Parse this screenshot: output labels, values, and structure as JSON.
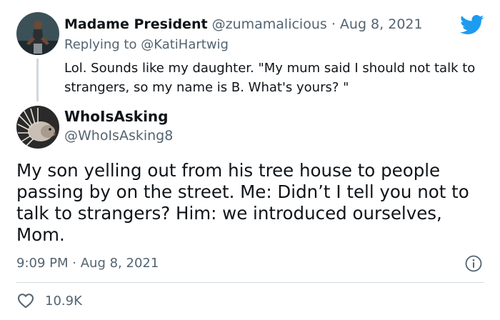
{
  "reply_tweet": {
    "author_name": "Madame President",
    "handle": "@zumamalicious",
    "separator": "·",
    "date": "Aug 8, 2021",
    "replying_prefix": "Replying to",
    "replying_to": "@KatiHartwig",
    "text": "Lol. Sounds like my daughter. \"My mum said I should not talk to strangers, so my name is B. What's yours? \""
  },
  "main_tweet": {
    "author_name": "WhoIsAsking",
    "handle": "@WhoIsAsking8",
    "text": "My son yelling out from his tree house to people passing by on the street. Me: Didn’t I tell you not to talk to strangers? Him: we introduced ourselves, Mom.",
    "time": "9:09 PM",
    "separator": "·",
    "date": "Aug 8, 2021",
    "likes": "10.9K"
  },
  "icons": {
    "brand": "twitter-bird-icon",
    "info": "info-icon",
    "like": "heart-icon"
  },
  "colors": {
    "twitter_blue": "#1d9bf0",
    "text_primary": "#0f1419",
    "text_secondary": "#536471",
    "divider": "#cfd9de"
  }
}
